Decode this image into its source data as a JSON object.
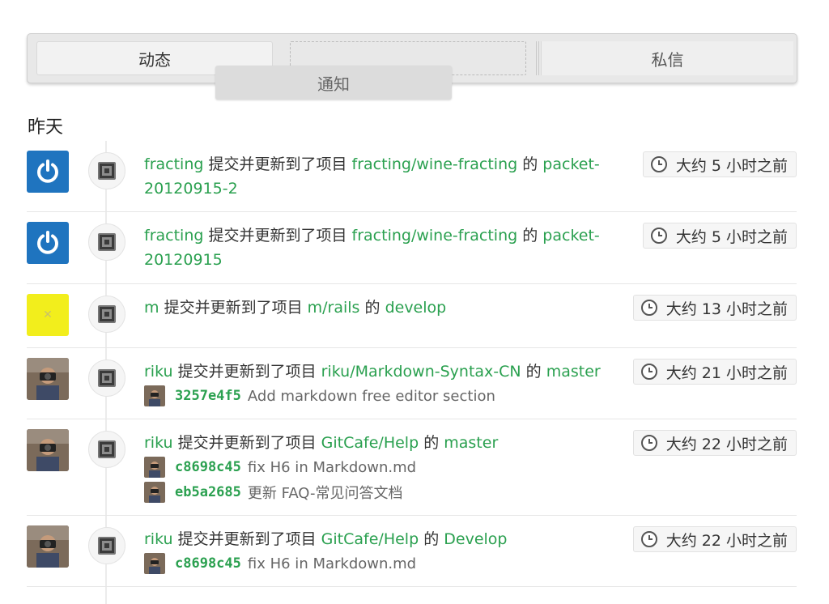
{
  "tabs": {
    "feed": "动态",
    "notifications": "通知",
    "messages": "私信"
  },
  "day_heading": "昨天",
  "action_text": "提交并更新到了项目",
  "connector": "的",
  "items": [
    {
      "user": "fracting",
      "project": "fracting/wine-fracting",
      "branch": "packet-20120915-2",
      "time": "大约 5 小时之前",
      "avatar": "power-icon-avatar",
      "commits": []
    },
    {
      "user": "fracting",
      "project": "fracting/wine-fracting",
      "branch": "packet-20120915",
      "time": "大约 5 小时之前",
      "avatar": "power-icon-avatar",
      "commits": []
    },
    {
      "user": "m",
      "project": "m/rails",
      "branch": "develop",
      "time": "大约 13 小时之前",
      "avatar": "placeholder-avatar",
      "commits": []
    },
    {
      "user": "riku",
      "project": "riku/Markdown-Syntax-CN",
      "branch": "master",
      "time": "大约 21 小时之前",
      "avatar": "photo-avatar",
      "commits": [
        {
          "hash": "3257e4f5",
          "message": "Add markdown free editor section"
        }
      ]
    },
    {
      "user": "riku",
      "project": "GitCafe/Help",
      "branch": "master",
      "time": "大约 22 小时之前",
      "avatar": "photo-avatar",
      "commits": [
        {
          "hash": "c8698c45",
          "message": "fix H6 in Markdown.md"
        },
        {
          "hash": "eb5a2685",
          "message": "更新 FAQ-常见问答文档"
        }
      ]
    },
    {
      "user": "riku",
      "project": "GitCafe/Help",
      "branch": "Develop",
      "time": "大约 22 小时之前",
      "avatar": "photo-avatar",
      "commits": [
        {
          "hash": "c8698c45",
          "message": "fix H6 in Markdown.md"
        }
      ]
    }
  ],
  "colors": {
    "link": "#2aa04f",
    "power_avatar": "#1f74bf",
    "placeholder_avatar": "#f2ee1c"
  }
}
